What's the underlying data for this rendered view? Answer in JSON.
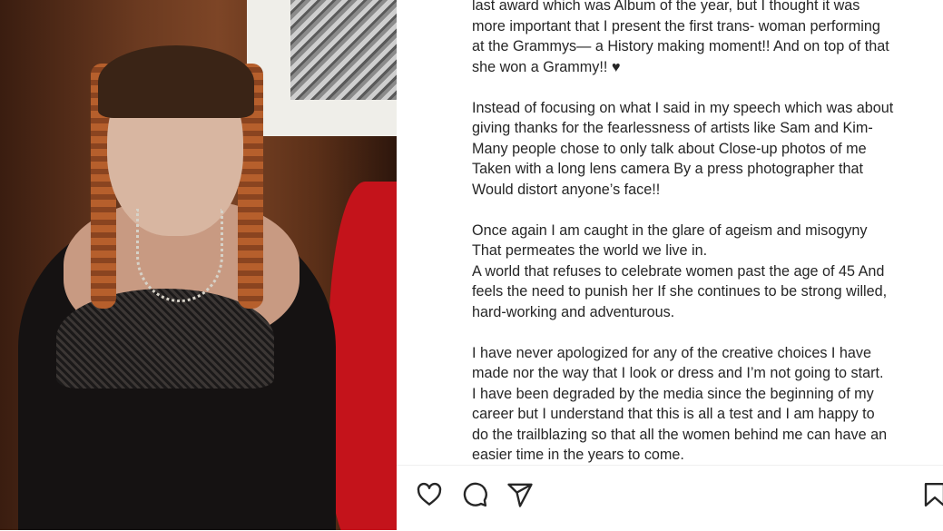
{
  "post": {
    "caption_paragraphs": [
      "last award which was Album of the year, but I thought it was\nmore important that I present the first trans- woman performing\nat the Grammys— a History making moment!! And on top of that\nshe won a Grammy!! ♥",
      "Instead of focusing on what I said in my speech which was about\ngiving thanks for the fearlessness of artists like Sam and Kim-\nMany people chose to only talk about Close-up photos of me\nTaken with a long lens camera By a press photographer that\nWould distort anyone’s face!!",
      "Once again I am caught in the glare of ageism and misogyny\nThat permeates the world we live in.\nA world that refuses to celebrate women past the age of 45 And\nfeels the need to punish her If she continues to be strong willed,\nhard-working and adventurous.",
      "I have never apologized for any of the creative choices I have\nmade nor the way that I look or dress and I’m not going to start.\nI have been degraded by the media since the beginning of my\ncareer but I understand that this is all a test and I am happy to\ndo the trailblazing so that all the women behind me can have an\neasier time in the years to come."
    ]
  },
  "actions": {
    "icons": [
      "heart-icon",
      "comment-icon",
      "share-icon",
      "bookmark-icon"
    ]
  }
}
